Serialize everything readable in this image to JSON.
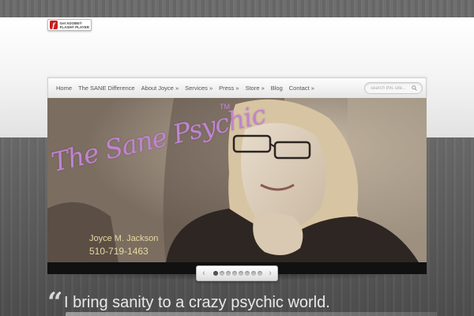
{
  "flash_badge": {
    "line1": "Get ADOBE®",
    "line2": "FLASH® PLAYER",
    "icon": "flash-player-icon"
  },
  "nav": {
    "items": [
      {
        "label": "Home"
      },
      {
        "label": "The SANE Difference"
      },
      {
        "label": "About Joyce »"
      },
      {
        "label": "Services »"
      },
      {
        "label": "Press »"
      },
      {
        "label": "Store »"
      },
      {
        "label": "Blog"
      },
      {
        "label": "Contact »"
      }
    ],
    "search_placeholder": "search this site..."
  },
  "slide": {
    "title": "The Sane Psychic",
    "trademark": "TM",
    "name": "Joyce M. Jackson",
    "phone": "510-719-1463"
  },
  "pager": {
    "prev": "‹",
    "next": "›",
    "total_slides": 8,
    "active_index": 0
  },
  "tagline": {
    "quote": "“",
    "text": "I bring sanity to a crazy psychic world."
  },
  "colors": {
    "accent_purple": "#c084d0",
    "slide_text": "#e8d8a0",
    "background_wood": "#5a5a5a"
  }
}
